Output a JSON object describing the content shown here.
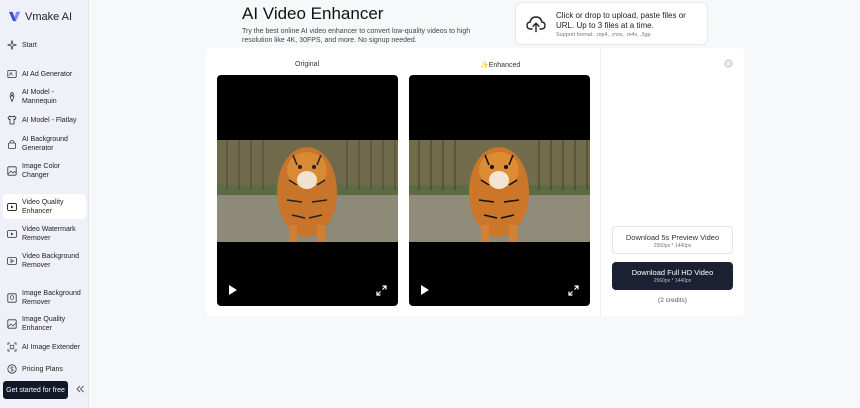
{
  "brand": {
    "name": "Vmake AI"
  },
  "sidebar": {
    "items": [
      {
        "label": "Start",
        "icon": "sparkle-icon"
      },
      {
        "label": "AI Ad Generator",
        "icon": "ad-icon"
      },
      {
        "label": "AI Model - Mannequin",
        "icon": "mannequin-icon"
      },
      {
        "label": "AI Model - Flatlay",
        "icon": "shirt-icon"
      },
      {
        "label": "AI Background Generator",
        "icon": "lock-bag-icon"
      },
      {
        "label": "Image Color Changer",
        "icon": "image-icon"
      },
      {
        "label": "Video Quality Enhancer",
        "icon": "video-icon"
      },
      {
        "label": "Video Watermark Remover",
        "icon": "video-eraser-icon"
      },
      {
        "label": "Video Background Remover",
        "icon": "video-bg-icon"
      },
      {
        "label": "Image Background Remover",
        "icon": "image-bg-icon"
      },
      {
        "label": "Image Quality Enhancer",
        "icon": "image-enhance-icon"
      },
      {
        "label": "AI Image Extender",
        "icon": "extend-icon"
      },
      {
        "label": "Pricing Plans",
        "icon": "price-icon"
      }
    ],
    "cta": "Get started for free"
  },
  "header": {
    "title": "AI Video Enhancer",
    "description": "Try the best online AI video enhancer to convert low-quality videos to high resolution like 4K, 30FPS, and more. No signup needed."
  },
  "upload": {
    "main": "Click or drop to upload, paste files or URL. Up to 3 files at a time.",
    "sub": "Support format: .mp4, .mov, .m4v, .3gp"
  },
  "compare": {
    "original_label": "Original",
    "enhanced_label": "✨Enhanced"
  },
  "download": {
    "preview_title": "Download 5s Preview Video",
    "preview_res": "2560px * 1440px",
    "full_title": "Download Full HD Video",
    "full_res": "2560px * 1440px",
    "credits": "(2 credits)"
  }
}
